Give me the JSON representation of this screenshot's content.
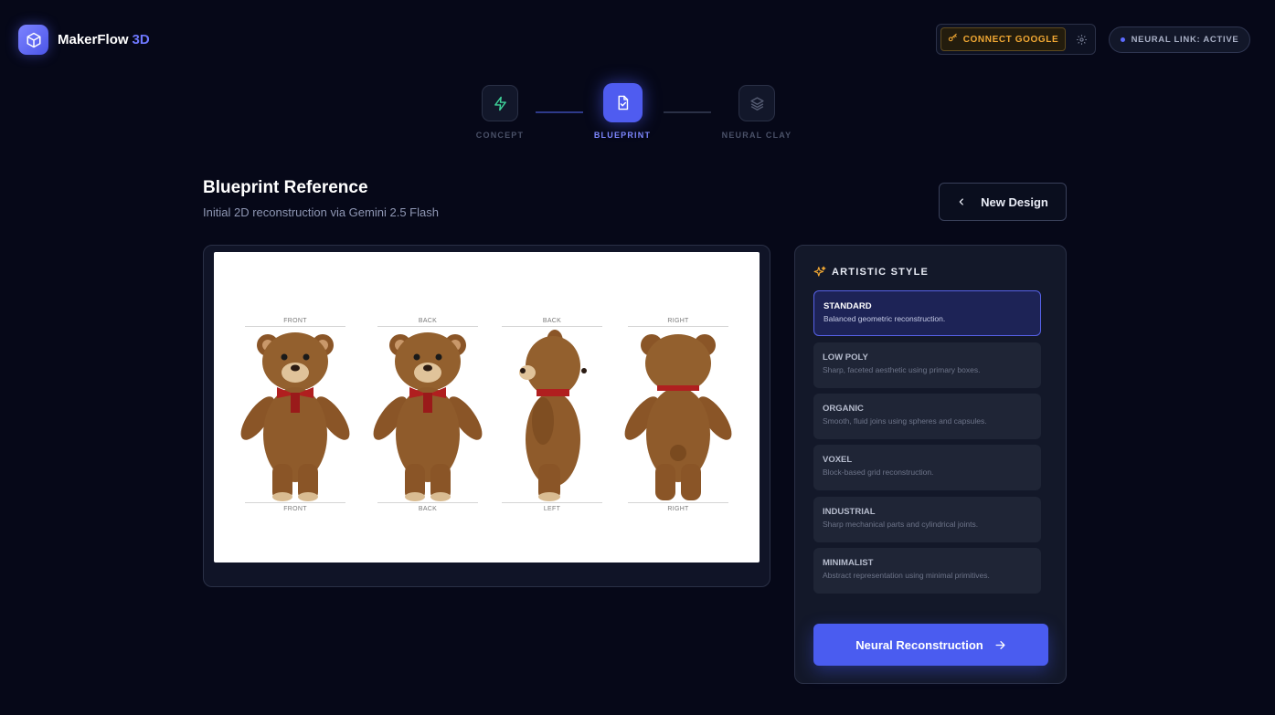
{
  "app": {
    "name": "MakerFlow",
    "name_accent": "3D"
  },
  "header": {
    "connect_label": "CONNECT GOOGLE",
    "status_label": "NEURAL LINK: ACTIVE"
  },
  "stepper": {
    "steps": [
      {
        "label": "CONCEPT",
        "icon": "lightning-icon",
        "state": "done"
      },
      {
        "label": "BLUEPRINT",
        "icon": "document-check-icon",
        "state": "active"
      },
      {
        "label": "NEURAL CLAY",
        "icon": "layers-icon",
        "state": "pending"
      }
    ]
  },
  "main": {
    "title": "Blueprint Reference",
    "subtitle": "Initial 2D reconstruction via Gemini 2.5 Flash",
    "new_design_label": "New Design"
  },
  "blueprint": {
    "views": [
      {
        "top": "FRONT",
        "bottom": "FRONT"
      },
      {
        "top": "BACK",
        "bottom": "BACK"
      },
      {
        "top": "BACK",
        "bottom": "LEFT"
      },
      {
        "top": "RIGHT",
        "bottom": "RIGHT"
      }
    ]
  },
  "style_panel": {
    "heading": "ARTISTIC STYLE",
    "options": [
      {
        "title": "STANDARD",
        "desc": "Balanced geometric reconstruction.",
        "selected": true
      },
      {
        "title": "LOW POLY",
        "desc": "Sharp, faceted aesthetic using primary boxes.",
        "selected": false
      },
      {
        "title": "ORGANIC",
        "desc": "Smooth, fluid joins using spheres and capsules.",
        "selected": false
      },
      {
        "title": "VOXEL",
        "desc": "Block-based grid reconstruction.",
        "selected": false
      },
      {
        "title": "INDUSTRIAL",
        "desc": "Sharp mechanical parts and cylindrical joints.",
        "selected": false
      },
      {
        "title": "MINIMALIST",
        "desc": "Abstract representation using minimal primitives.",
        "selected": false
      }
    ],
    "action_label": "Neural Reconstruction"
  },
  "colors": {
    "accent": "#4f5cf0",
    "background": "#060818",
    "warning": "#f0a733",
    "concept_icon": "#3fd39a"
  }
}
